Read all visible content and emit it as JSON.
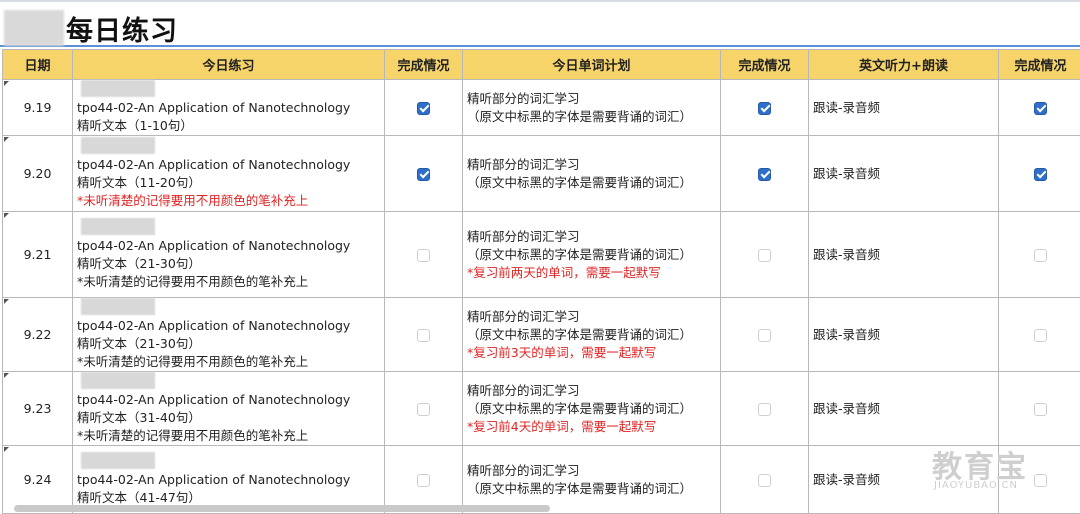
{
  "title": "每日练习",
  "headers": [
    "日期",
    "今日练习",
    "完成情况",
    "今日单词计划",
    "完成情况",
    "英文听力+朗读",
    "完成情况"
  ],
  "rows": [
    {
      "date": "9.19",
      "practice": "tpo44-02-An Application of Nanotechnology",
      "range": "精听文本（1-10句）",
      "note": "",
      "note_red": false,
      "done1": true,
      "vocab1": "精听部分的词汇学习",
      "vocab2": "（原文中标黑的字体是需要背诵的词汇）",
      "vocab_note": "",
      "done2": true,
      "listen": "跟读-录音频",
      "done3": true
    },
    {
      "date": "9.20",
      "practice": "tpo44-02-An Application of Nanotechnology",
      "range": "精听文本（11-20句）",
      "note": "*未听清楚的记得要用不用颜色的笔补充上",
      "note_red": true,
      "done1": true,
      "vocab1": "精听部分的词汇学习",
      "vocab2": "（原文中标黑的字体是需要背诵的词汇）",
      "vocab_note": "",
      "done2": true,
      "listen": "跟读-录音频",
      "done3": true
    },
    {
      "date": "9.21",
      "practice": "tpo44-02-An Application of Nanotechnology",
      "range": "精听文本（21-30句）",
      "note": "*未听清楚的记得要用不用颜色的笔补充上",
      "note_red": false,
      "done1": false,
      "vocab1": "精听部分的词汇学习",
      "vocab2": "（原文中标黑的字体是需要背诵的词汇）",
      "vocab_note": "*复习前两天的单词，需要一起默写",
      "done2": false,
      "listen": "跟读-录音频",
      "done3": false
    },
    {
      "date": "9.22",
      "practice": "tpo44-02-An Application of Nanotechnology",
      "range": "精听文本（21-30句）",
      "note": "*未听清楚的记得要用不用颜色的笔补充上",
      "note_red": false,
      "done1": false,
      "vocab1": "精听部分的词汇学习",
      "vocab2": "（原文中标黑的字体是需要背诵的词汇）",
      "vocab_note": "*复习前3天的单词，需要一起默写",
      "done2": false,
      "listen": "跟读-录音频",
      "done3": false
    },
    {
      "date": "9.23",
      "practice": "tpo44-02-An Application of Nanotechnology",
      "range": "精听文本（31-40句）",
      "note": "*未听清楚的记得要用不用颜色的笔补充上",
      "note_red": false,
      "done1": false,
      "vocab1": "精听部分的词汇学习",
      "vocab2": "（原文中标黑的字体是需要背诵的词汇）",
      "vocab_note": "*复习前4天的单词，需要一起默写",
      "done2": false,
      "listen": "跟读-录音频",
      "done3": false
    },
    {
      "date": "9.24",
      "practice": "tpo44-02-An Application of Nanotechnology",
      "range": "精听文本（41-47句）",
      "note": "",
      "note_red": false,
      "done1": false,
      "vocab1": "精听部分的词汇学习",
      "vocab2": "（原文中标黑的字体是需要背诵的词汇）",
      "vocab_note": "",
      "done2": false,
      "listen": "跟读-录音频",
      "done3": false
    }
  ],
  "watermark": {
    "cn": "教育宝",
    "en": "JIAOYUBAO.CN"
  },
  "colors": {
    "header_bg": "#f7d46a",
    "checkbox_on": "#2f6fc9",
    "note_red": "#e02424",
    "rule_blue": "#5b8fd6"
  }
}
